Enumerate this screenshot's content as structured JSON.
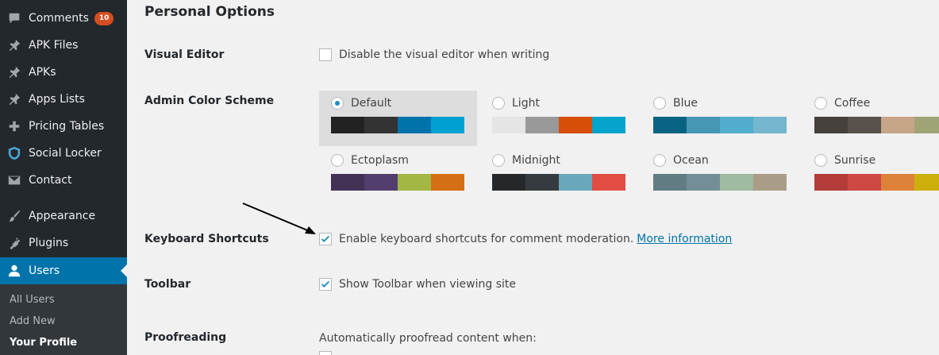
{
  "sidebar": {
    "items": [
      {
        "label": "Comments",
        "icon": "comment-icon",
        "badge": "10"
      },
      {
        "label": "APK Files",
        "icon": "pin-icon"
      },
      {
        "label": "APKs",
        "icon": "pin-icon"
      },
      {
        "label": "Apps Lists",
        "icon": "pin-icon"
      },
      {
        "label": "Pricing Tables",
        "icon": "plus-icon"
      },
      {
        "label": "Social Locker",
        "icon": "shield-icon"
      },
      {
        "label": "Contact",
        "icon": "mail-icon"
      },
      {
        "label": "Appearance",
        "icon": "brush-icon"
      },
      {
        "label": "Plugins",
        "icon": "plugin-icon"
      },
      {
        "label": "Users",
        "icon": "user-icon",
        "active": true
      }
    ],
    "submenu": [
      "All Users",
      "Add New",
      "Your Profile"
    ],
    "colors": {
      "background": "#23282d",
      "submenu": "#32373c",
      "active": "#0073aa"
    }
  },
  "main": {
    "section_title": "Personal Options",
    "visual_editor": {
      "label": "Visual Editor",
      "checkbox_text": "Disable the visual editor when writing",
      "checked": false
    },
    "color_scheme": {
      "label": "Admin Color Scheme",
      "schemes": [
        {
          "name": "Default",
          "selected": true,
          "colors": [
            "#222222",
            "#333333",
            "#0073aa",
            "#00a0d2"
          ]
        },
        {
          "name": "Light",
          "selected": false,
          "colors": [
            "#e5e5e5",
            "#999999",
            "#d64e07",
            "#04a4cc"
          ]
        },
        {
          "name": "Blue",
          "selected": false,
          "colors": [
            "#096484",
            "#4796b3",
            "#52accc",
            "#74b6ce"
          ]
        },
        {
          "name": "Coffee",
          "selected": false,
          "colors": [
            "#46403c",
            "#59524c",
            "#c7a589",
            "#9ea476"
          ]
        },
        {
          "name": "Ectoplasm",
          "selected": false,
          "colors": [
            "#413256",
            "#523f6d",
            "#a3b745",
            "#d46f15"
          ]
        },
        {
          "name": "Midnight",
          "selected": false,
          "colors": [
            "#25282b",
            "#363b3f",
            "#69a8bb",
            "#e14d43"
          ]
        },
        {
          "name": "Ocean",
          "selected": false,
          "colors": [
            "#627c83",
            "#738e96",
            "#9ebaa0",
            "#aa9d88"
          ]
        },
        {
          "name": "Sunrise",
          "selected": false,
          "colors": [
            "#b43c38",
            "#cf4944",
            "#dd823b",
            "#ccaf0b"
          ]
        }
      ]
    },
    "keyboard_shortcuts": {
      "label": "Keyboard Shortcuts",
      "checkbox_text": "Enable keyboard shortcuts for comment moderation.",
      "link_text": "More information",
      "checked": true
    },
    "toolbar": {
      "label": "Toolbar",
      "checkbox_text": "Show Toolbar when viewing site",
      "checked": true
    },
    "proofreading": {
      "label": "Proofreading",
      "text": "Automatically proofread content when:"
    },
    "colors": {
      "link": "#0073aa",
      "check": "#1e8cbe",
      "selected_scheme_bg": "#dddddd"
    }
  }
}
